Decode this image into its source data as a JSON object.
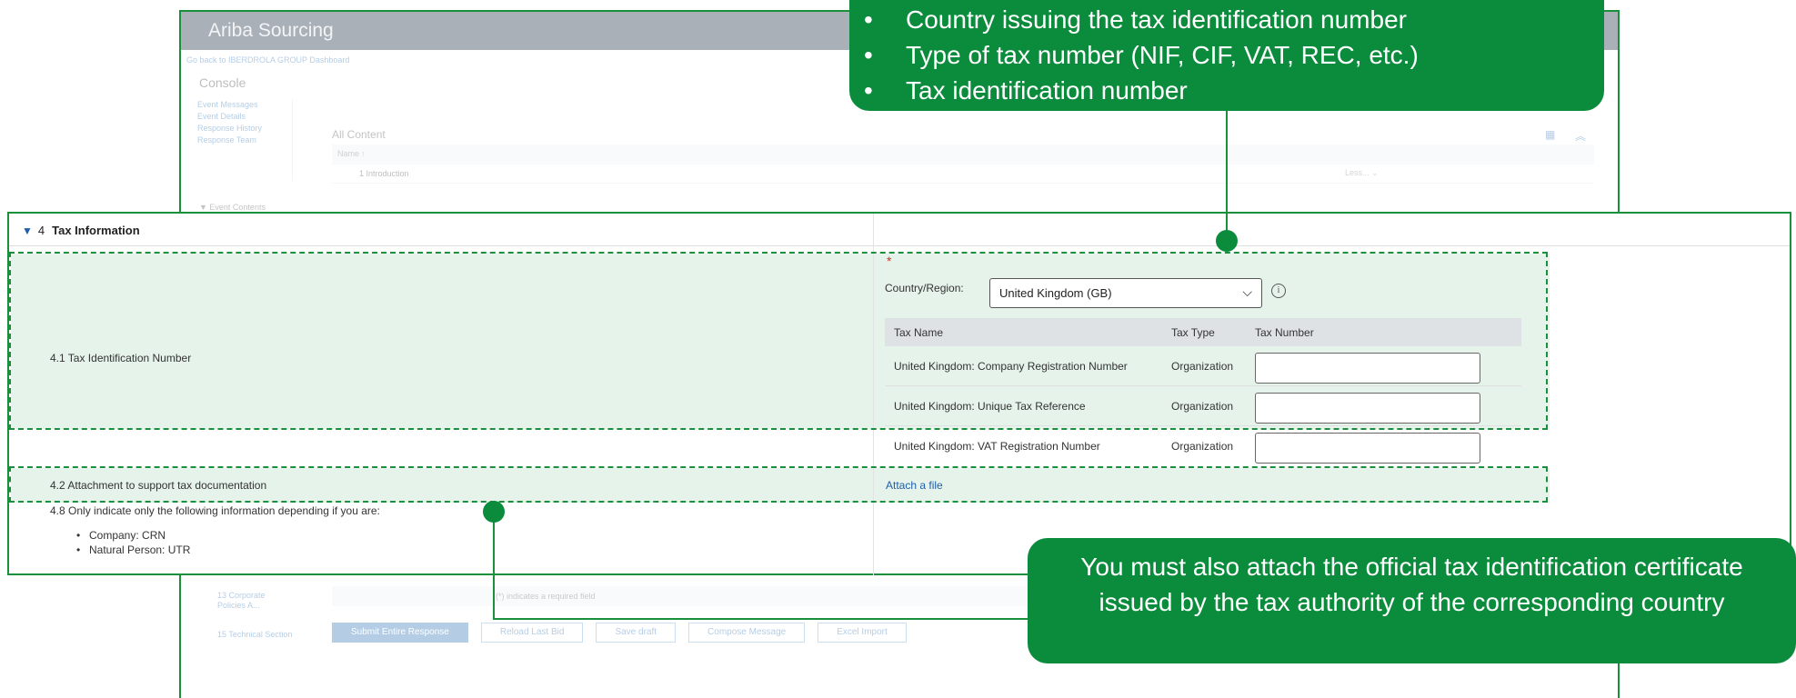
{
  "background_app": {
    "title": "Ariba Sourcing",
    "back_link": "Go back to IBERDROLA GROUP Dashboard",
    "console": "Console",
    "sidebar_items": [
      "Event Messages",
      "Event Details",
      "Response History",
      "Response Team"
    ],
    "event_contents": "▼ Event Contents",
    "all_content": "All Content",
    "name_header": "Name ↑",
    "intro_row": "1  Introduction",
    "less": "Less... ⌄",
    "corporate_policies": "13  Corporate Policies A...",
    "technical_section": "15  Technical Section",
    "required_note": "(*) indicates a required field",
    "buttons": [
      "Submit Entire Response",
      "Reload Last Bid",
      "Save draft",
      "Compose Message",
      "Excel Import"
    ]
  },
  "tax_section": {
    "number": "4",
    "title": "Tax Information",
    "q41": "4.1  Tax Identification Number",
    "q42": "4.2  Attachment to support tax documentation",
    "q48": "4.8  Only indicate only the following information depending if you are:",
    "q48_bullets": [
      "Company: CRN",
      "Natural Person: UTR"
    ],
    "required_marker": "*",
    "country_label": "Country/Region:",
    "country_value": "United Kingdom (GB)",
    "table_headers": [
      "Tax Name",
      "Tax Type",
      "Tax Number"
    ],
    "rows": [
      {
        "name": "United Kingdom: Company Registration Number",
        "type": "Organization",
        "number": ""
      },
      {
        "name": "United Kingdom: Unique Tax Reference",
        "type": "Organization",
        "number": ""
      },
      {
        "name": "United Kingdom: VAT Registration Number",
        "type": "Organization",
        "number": ""
      }
    ],
    "attach_link": "Attach a file"
  },
  "callouts": {
    "top_bullets": [
      "Country issuing the tax identification number",
      "Type of tax number (NIF, CIF, VAT, REC, etc.)",
      "Tax identification number"
    ],
    "bottom_text": "You must also attach the official tax identification certificate issued by the tax authority of the corresponding country"
  },
  "colors": {
    "accent_green": "#0b8c3c",
    "highlight_fill": "#e6f3ea",
    "link_blue": "#1f5fa8"
  }
}
